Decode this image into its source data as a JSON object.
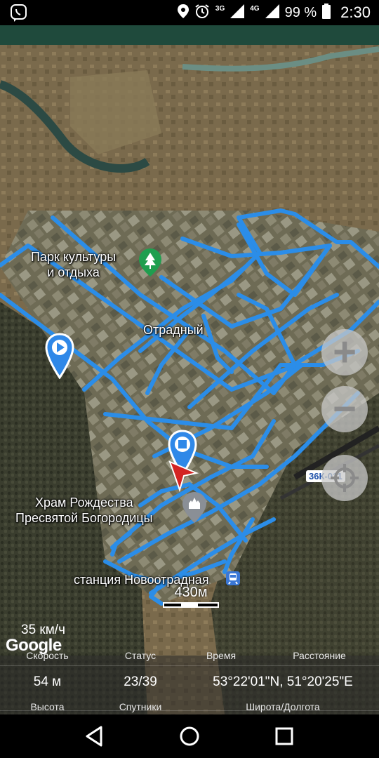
{
  "status_bar": {
    "left_icon": "viber-icon",
    "icons": [
      "location-icon",
      "alarm-icon",
      "signal-3g-icon",
      "signal-4g-icon"
    ],
    "net1": "3G",
    "net2": "4G",
    "battery": "99 %",
    "time": "2:30"
  },
  "map": {
    "labels": {
      "park": "Парк культуры\nи отдыха",
      "town": "Отрадный",
      "church": "Храм Рождества\nПресвятой Богородицы",
      "station": "станция Новоотрадная",
      "road": "36К-011"
    },
    "scale_text": "430м",
    "provider": "Google",
    "speed": "35 км/ч",
    "track_color": "#2b8de8",
    "start_marker_color": "#2f88e8",
    "heading_color": "#d32323",
    "controls": {
      "zoom_in": "+",
      "zoom_out": "−"
    }
  },
  "stats": {
    "speed_label": "Скорость",
    "status_label": "Статус",
    "time_label": "Время",
    "distance_label": "Расстояние",
    "altitude_value": "54 м",
    "satellites_value": "23/39",
    "coordinates_value": "53°22'01\"N, 51°20'25\"E",
    "altitude_label": "Высота",
    "satellites_label": "Спутники",
    "coordinates_label": "Широта/Долгота"
  },
  "nav": {
    "icons": [
      "back-icon",
      "home-icon",
      "recents-icon"
    ]
  }
}
